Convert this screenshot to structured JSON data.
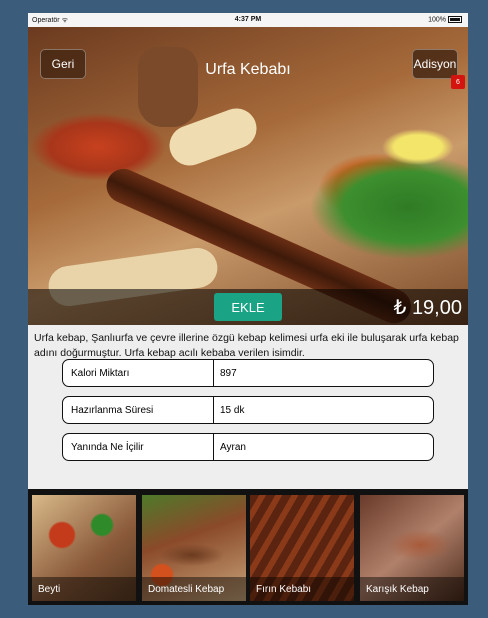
{
  "status_bar": {
    "carrier": "Operatör ᯤ",
    "time": "4:37 PM",
    "battery": "100%"
  },
  "header": {
    "back_label": "Geri",
    "title": "Urfa Kebabı",
    "order_label": "Adisyon",
    "order_count": "6"
  },
  "product": {
    "add_label": "EKLE",
    "price": "₺ 19,00",
    "description": "Urfa kebap, Şanlıurfa ve çevre illerine özgü kebap kelimesi urfa eki ile buluşarak urfa kebap adını doğurmuştur. Urfa kebap acılı kebaba verilen isimdir."
  },
  "info": [
    {
      "key": "Kalori Miktarı",
      "value": "897"
    },
    {
      "key": "Hazırlanma Süresi",
      "value": "15 dk"
    },
    {
      "key": "Yanında Ne İçilir",
      "value": "Ayran"
    }
  ],
  "related": [
    {
      "label": "Beyti"
    },
    {
      "label": "Domatesli Kebap"
    },
    {
      "label": "Fırın Kebabı"
    },
    {
      "label": "Karışık Kebap"
    }
  ]
}
